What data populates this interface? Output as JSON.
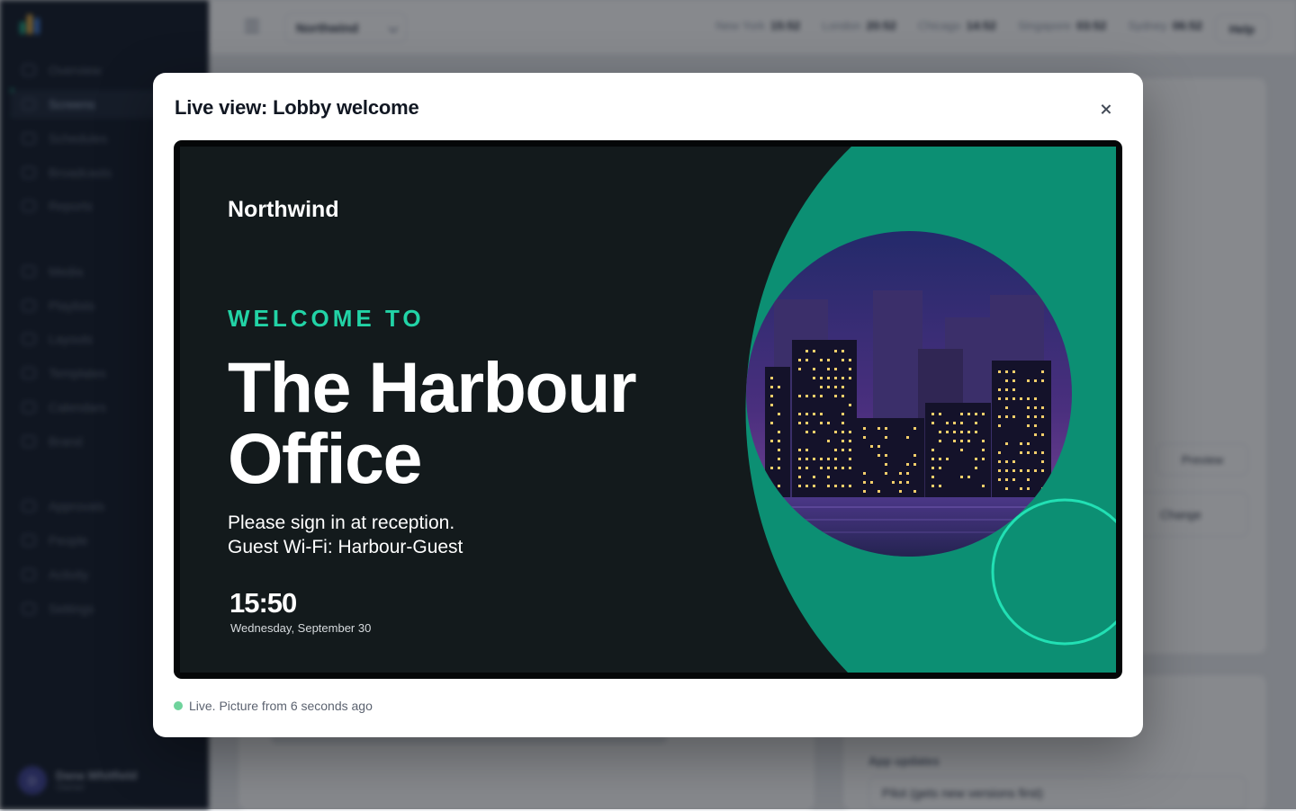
{
  "app": {
    "org": "Northwind",
    "help": "Help",
    "clocks": [
      {
        "city": "New York",
        "time": "15:52"
      },
      {
        "city": "London",
        "time": "20:52"
      },
      {
        "city": "Chicago",
        "time": "14:52"
      },
      {
        "city": "Singapore",
        "time": "03:52"
      },
      {
        "city": "Sydney",
        "time": "06:52"
      }
    ],
    "nav": [
      {
        "label": "Overview",
        "icon": "grid-icon"
      },
      {
        "label": "Screens",
        "icon": "monitor-icon"
      },
      {
        "label": "Schedules",
        "icon": "calendar-icon"
      },
      {
        "label": "Broadcasts",
        "icon": "megaphone-icon"
      },
      {
        "label": "Reports",
        "icon": "chart-icon"
      },
      {
        "label": "Media",
        "icon": "image-icon"
      },
      {
        "label": "Playlists",
        "icon": "playlist-icon"
      },
      {
        "label": "Layouts",
        "icon": "layout-icon"
      },
      {
        "label": "Templates",
        "icon": "template-icon"
      },
      {
        "label": "Calendars",
        "icon": "calendar-icon"
      },
      {
        "label": "Brand",
        "icon": "palette-icon"
      },
      {
        "label": "Approvals",
        "icon": "check-circle-icon"
      },
      {
        "label": "People",
        "icon": "users-icon"
      },
      {
        "label": "Activity",
        "icon": "activity-icon"
      },
      {
        "label": "Settings",
        "icon": "gear-icon"
      }
    ],
    "user": {
      "initial": "D",
      "name": "Dana Whitfield",
      "role": "Owner"
    },
    "preview": "Preview",
    "change": "Change",
    "app_updates_label": "App updates",
    "app_updates_value": "Pilot (gets new versions first)"
  },
  "modal": {
    "title": "Live view: Lobby welcome",
    "status": "Live. Picture from 6 seconds ago"
  },
  "sign": {
    "brand": "Northwind",
    "welcome": "WELCOME TO",
    "headline": "The Harbour Office",
    "line1": "Please sign in at reception.",
    "line2": "Guest Wi-Fi: Harbour-Guest",
    "time": "15:50",
    "date": "Wednesday, September 30"
  },
  "colors": {
    "sign_accent": "#22d3a6",
    "sign_panel": "#0c8f73",
    "sign_background": "#131a1c",
    "live_dot": "#6fd39c"
  }
}
